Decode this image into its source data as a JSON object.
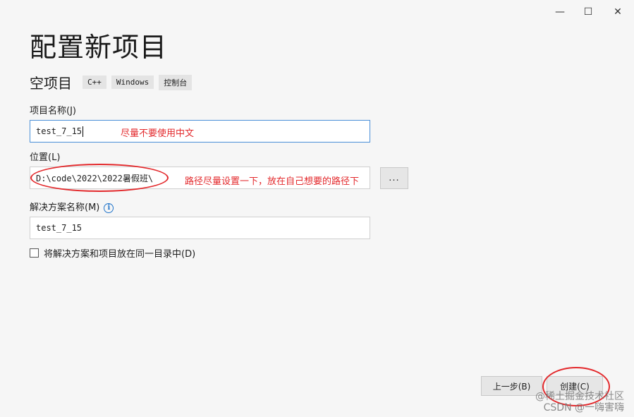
{
  "window": {
    "minimize_glyph": "—",
    "maximize_glyph": "☐",
    "close_glyph": "✕"
  },
  "title": "配置新项目",
  "project_type": {
    "name": "空项目",
    "tags": [
      "C++",
      "Windows",
      "控制台"
    ]
  },
  "project_name": {
    "label": "项目名称(J)",
    "value": "test_7_15",
    "annotation": "尽量不要使用中文"
  },
  "location": {
    "label": "位置(L)",
    "value": "D:\\code\\2022\\2022暑假班\\",
    "annotation": "路径尽量设置一下，放在自己想要的路径下",
    "browse_label": "..."
  },
  "solution_name": {
    "label": "解决方案名称(M)",
    "value": "test_7_15",
    "info_icon": "info-icon"
  },
  "same_dir_checkbox": {
    "label": "将解决方案和项目放在同一目录中(D)",
    "checked": false
  },
  "footer": {
    "back_label": "上一步(B)",
    "create_label": "创建(C)"
  },
  "watermark": {
    "line1": "@稀土掘金技术社区",
    "line2": "CSDN @一嗨害嗨"
  },
  "colors": {
    "annotation": "#e3292c",
    "focus_border": "#4a8fd8",
    "info": "#1f73c9"
  }
}
